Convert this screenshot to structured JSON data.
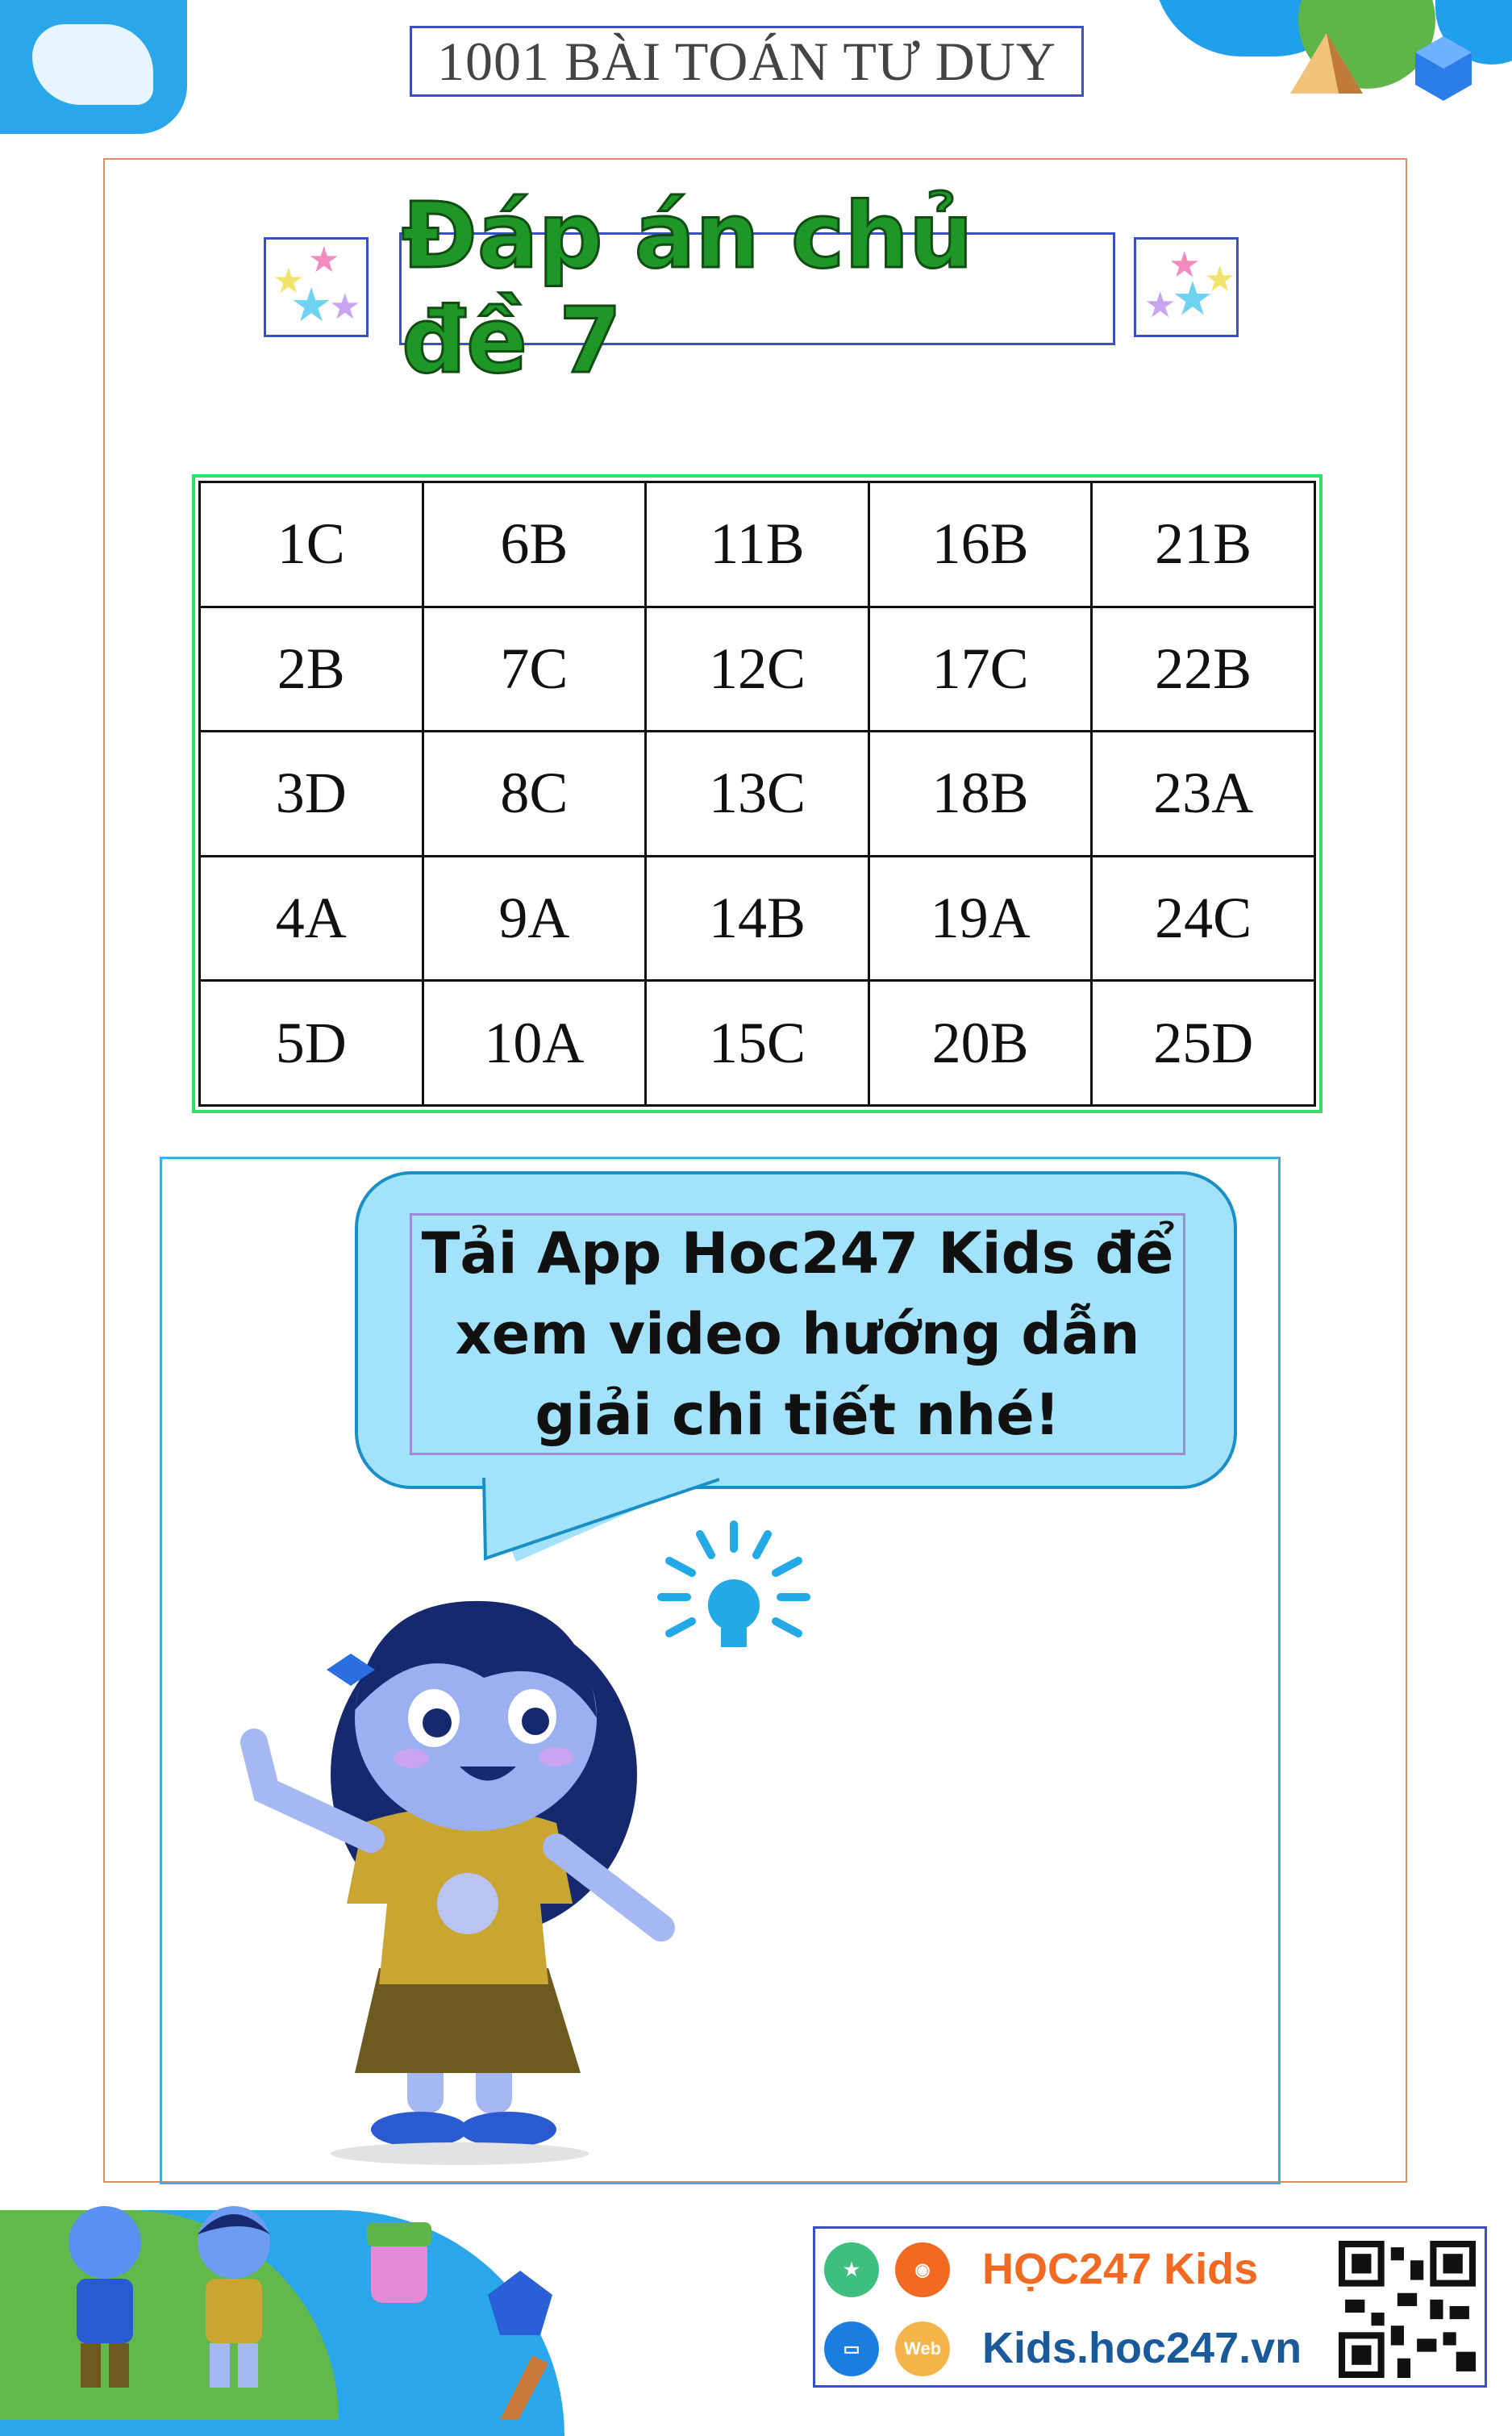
{
  "header": {
    "book_title": "1001 BÀI TOÁN TƯ DUY"
  },
  "main": {
    "title": "Đáp án chủ đề 7",
    "answers": [
      [
        "1C",
        "6B",
        "11B",
        "16B",
        "21B"
      ],
      [
        "2B",
        "7C",
        "12C",
        "17C",
        "22B"
      ],
      [
        "3D",
        "8C",
        "13C",
        "18B",
        "23A"
      ],
      [
        "4A",
        "9A",
        "14B",
        "19A",
        "24C"
      ],
      [
        "5D",
        "10A",
        "15C",
        "20B",
        "25D"
      ]
    ],
    "speech_bubble": "Tải App Hoc247 Kids để\nxem video hướng dẫn\ngiải chi tiết nhé!"
  },
  "footer": {
    "brand": "HỌC247 Kids",
    "website": "Kids.hoc247.vn",
    "web_badge": "Web"
  },
  "colors": {
    "title_green": "#1e9628",
    "accent_blue": "#1ea0ea",
    "brand_orange": "#f26a21"
  }
}
